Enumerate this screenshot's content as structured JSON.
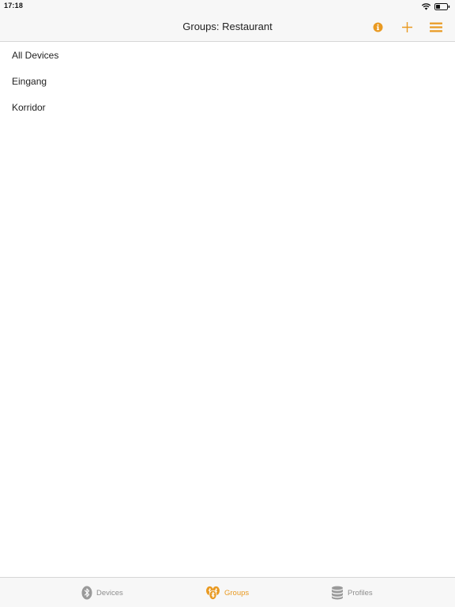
{
  "status": {
    "time": "17:18"
  },
  "nav": {
    "title": "Groups: Restaurant"
  },
  "groups": [
    {
      "label": "All Devices"
    },
    {
      "label": "Eingang"
    },
    {
      "label": "Korridor"
    }
  ],
  "tabs": [
    {
      "label": "Devices",
      "icon": "bluetooth-icon",
      "active": false
    },
    {
      "label": "Groups",
      "icon": "groups-icon",
      "active": true
    },
    {
      "label": "Profiles",
      "icon": "database-icon",
      "active": false
    }
  ],
  "colors": {
    "accent": "#e99a22",
    "inactive": "#8e8e8e",
    "bar_bg": "#f7f7f7"
  }
}
